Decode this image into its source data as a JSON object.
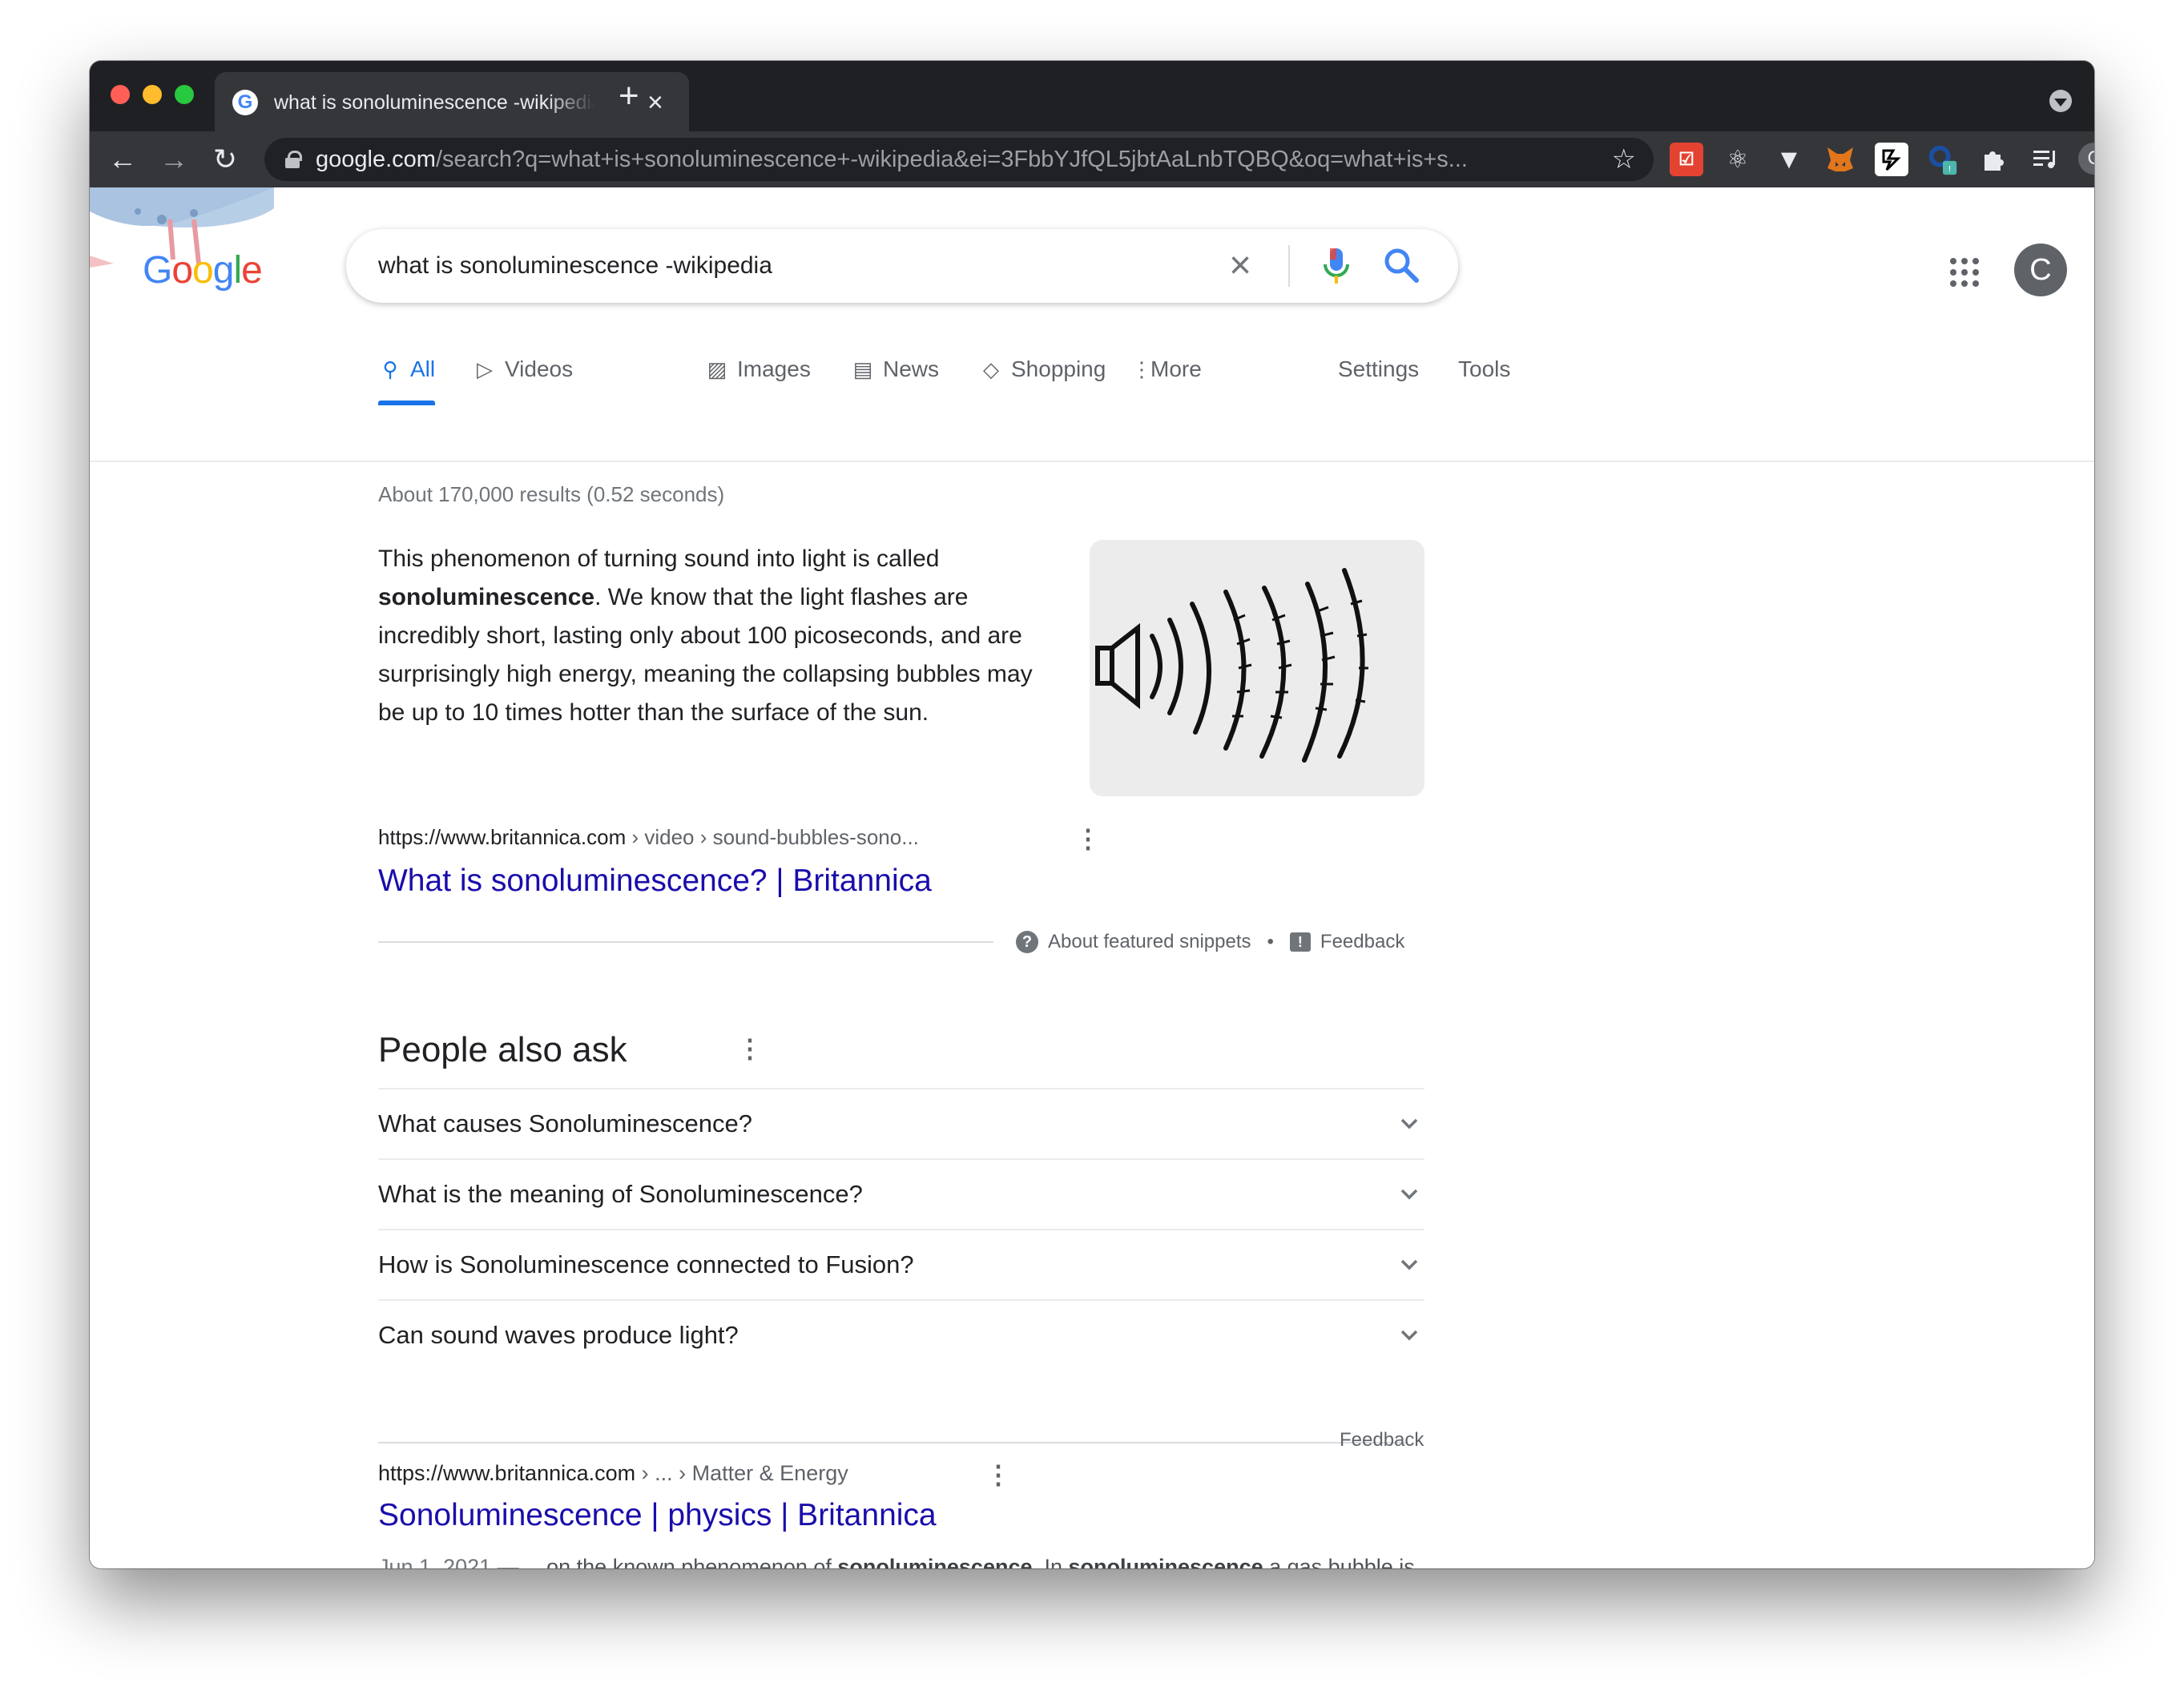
{
  "browser": {
    "tab_title": "what is sonoluminescence -wikipedia - Google Search",
    "url_host": "google.com",
    "url_path": "/search?q=what+is+sonoluminescence+-wikipedia&ei=3FbbYJfQL5jbtAaLnbTQBQ&oq=what+is+s...",
    "profile_initial": "C",
    "extensions": [
      "todoist-icon",
      "react-devtools-icon",
      "vue-devtools-icon",
      "metamask-icon",
      "extension-icon",
      "extension-badge-icon",
      "puzzle-icon",
      "media-queue-icon"
    ]
  },
  "search": {
    "query": "what is sonoluminescence -wikipedia",
    "logo": "Google"
  },
  "account": {
    "initial": "C"
  },
  "tabs": {
    "all": "All",
    "videos": "Videos",
    "images": "Images",
    "news": "News",
    "shopping": "Shopping",
    "more": "More",
    "settings": "Settings",
    "tools": "Tools"
  },
  "stats": "About 170,000 results (0.52 seconds)",
  "snippet": {
    "text_1": "This phenomenon of turning sound into light is called ",
    "bold": "sonoluminescence",
    "text_2": ". We know that the light flashes are incredibly short, lasting only about 100 picoseconds, and are surprisingly high energy, meaning the collapsing bubbles may be up to 10 times hotter than the surface of the sun.",
    "url_host": "https://www.britannica.com",
    "url_path": " › video › sound-bubbles-sono...",
    "title": "What is sonoluminescence? | Britannica",
    "about": "About featured snippets",
    "separator": "•",
    "feedback": "Feedback"
  },
  "paa": {
    "heading": "People also ask",
    "questions": [
      "What causes Sonoluminescence?",
      "What is the meaning of Sonoluminescence?",
      "How is Sonoluminescence connected to Fusion?",
      "Can sound waves produce light?"
    ],
    "feedback": "Feedback"
  },
  "result2": {
    "url_host": "https://www.britannica.com",
    "url_path": " › ... › Matter & Energy",
    "title": "Sonoluminescence | physics | Britannica",
    "date": "Jun 1, 2021 — ",
    "d1": "…on the known phenomenon of ",
    "b1": "sonoluminescence",
    "d2": ". In ",
    "b2": "sonoluminescence",
    "d3": " a gas bubble is imploded with high-pressure sound waves."
  },
  "colors": {
    "link": "#1a0dab",
    "accent": "#1a73e8",
    "chrome_dark": "#35363a"
  }
}
